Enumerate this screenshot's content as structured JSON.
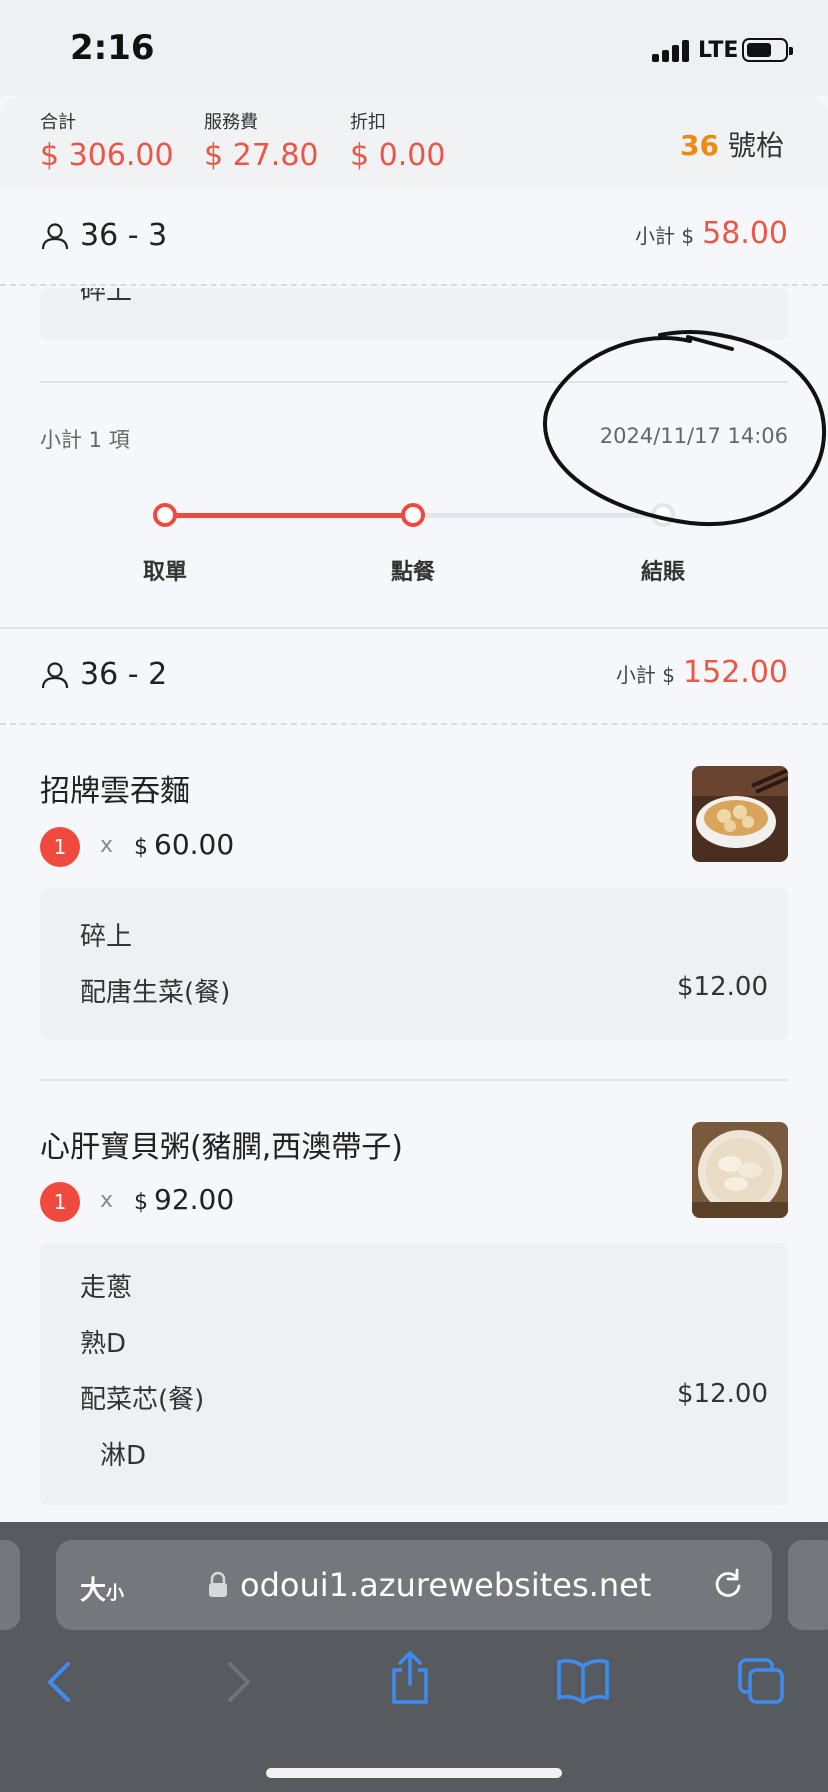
{
  "status_bar": {
    "time": "2:16",
    "network": "LTE",
    "icons": [
      "signal-icon",
      "battery-icon"
    ]
  },
  "totals": {
    "total_label": "合計",
    "total_value": "$ 306.00",
    "service_label": "服務費",
    "service_value": "$ 27.80",
    "discount_label": "折扣",
    "discount_value": "$ 0.00",
    "table_number": "36",
    "table_suffix": "號枱"
  },
  "section_1": {
    "seat": "36 - 3",
    "subtotal_label": "小計 $",
    "subtotal_value": "58.00",
    "partial_note": "碎上",
    "item_count": "小計 1 項",
    "timestamp": "2024/11/17 14:06",
    "progress": {
      "steps": [
        "取單",
        "點餐",
        "結賬"
      ],
      "completed": 2
    }
  },
  "section_2": {
    "seat": "36 - 2",
    "subtotal_label": "小計 $",
    "subtotal_value": "152.00",
    "items": [
      {
        "name": "招牌雲吞麵",
        "qty": "1",
        "times": "x",
        "currency": "$",
        "price": "60.00",
        "notes": [
          {
            "text": "碎上",
            "price": ""
          },
          {
            "text": "配唐生菜(餐)",
            "price": "$12.00"
          }
        ]
      },
      {
        "name": "心肝寶貝粥(豬膶,西澳帶子)",
        "qty": "1",
        "times": "x",
        "currency": "$",
        "price": "92.00",
        "notes": [
          {
            "text": "走蔥",
            "price": ""
          },
          {
            "text": "熟D",
            "price": ""
          },
          {
            "text": "配菜芯(餐)",
            "price": "$12.00"
          },
          {
            "text": "淋D",
            "price": ""
          }
        ]
      }
    ]
  },
  "browser": {
    "text_size_label": "大",
    "text_size_small": "小",
    "url": "odoui1.azurewebsites.net",
    "accent": "#3f8cf0"
  },
  "colors": {
    "accent_red": "#ef5545",
    "table_orange": "#ef8a10"
  }
}
